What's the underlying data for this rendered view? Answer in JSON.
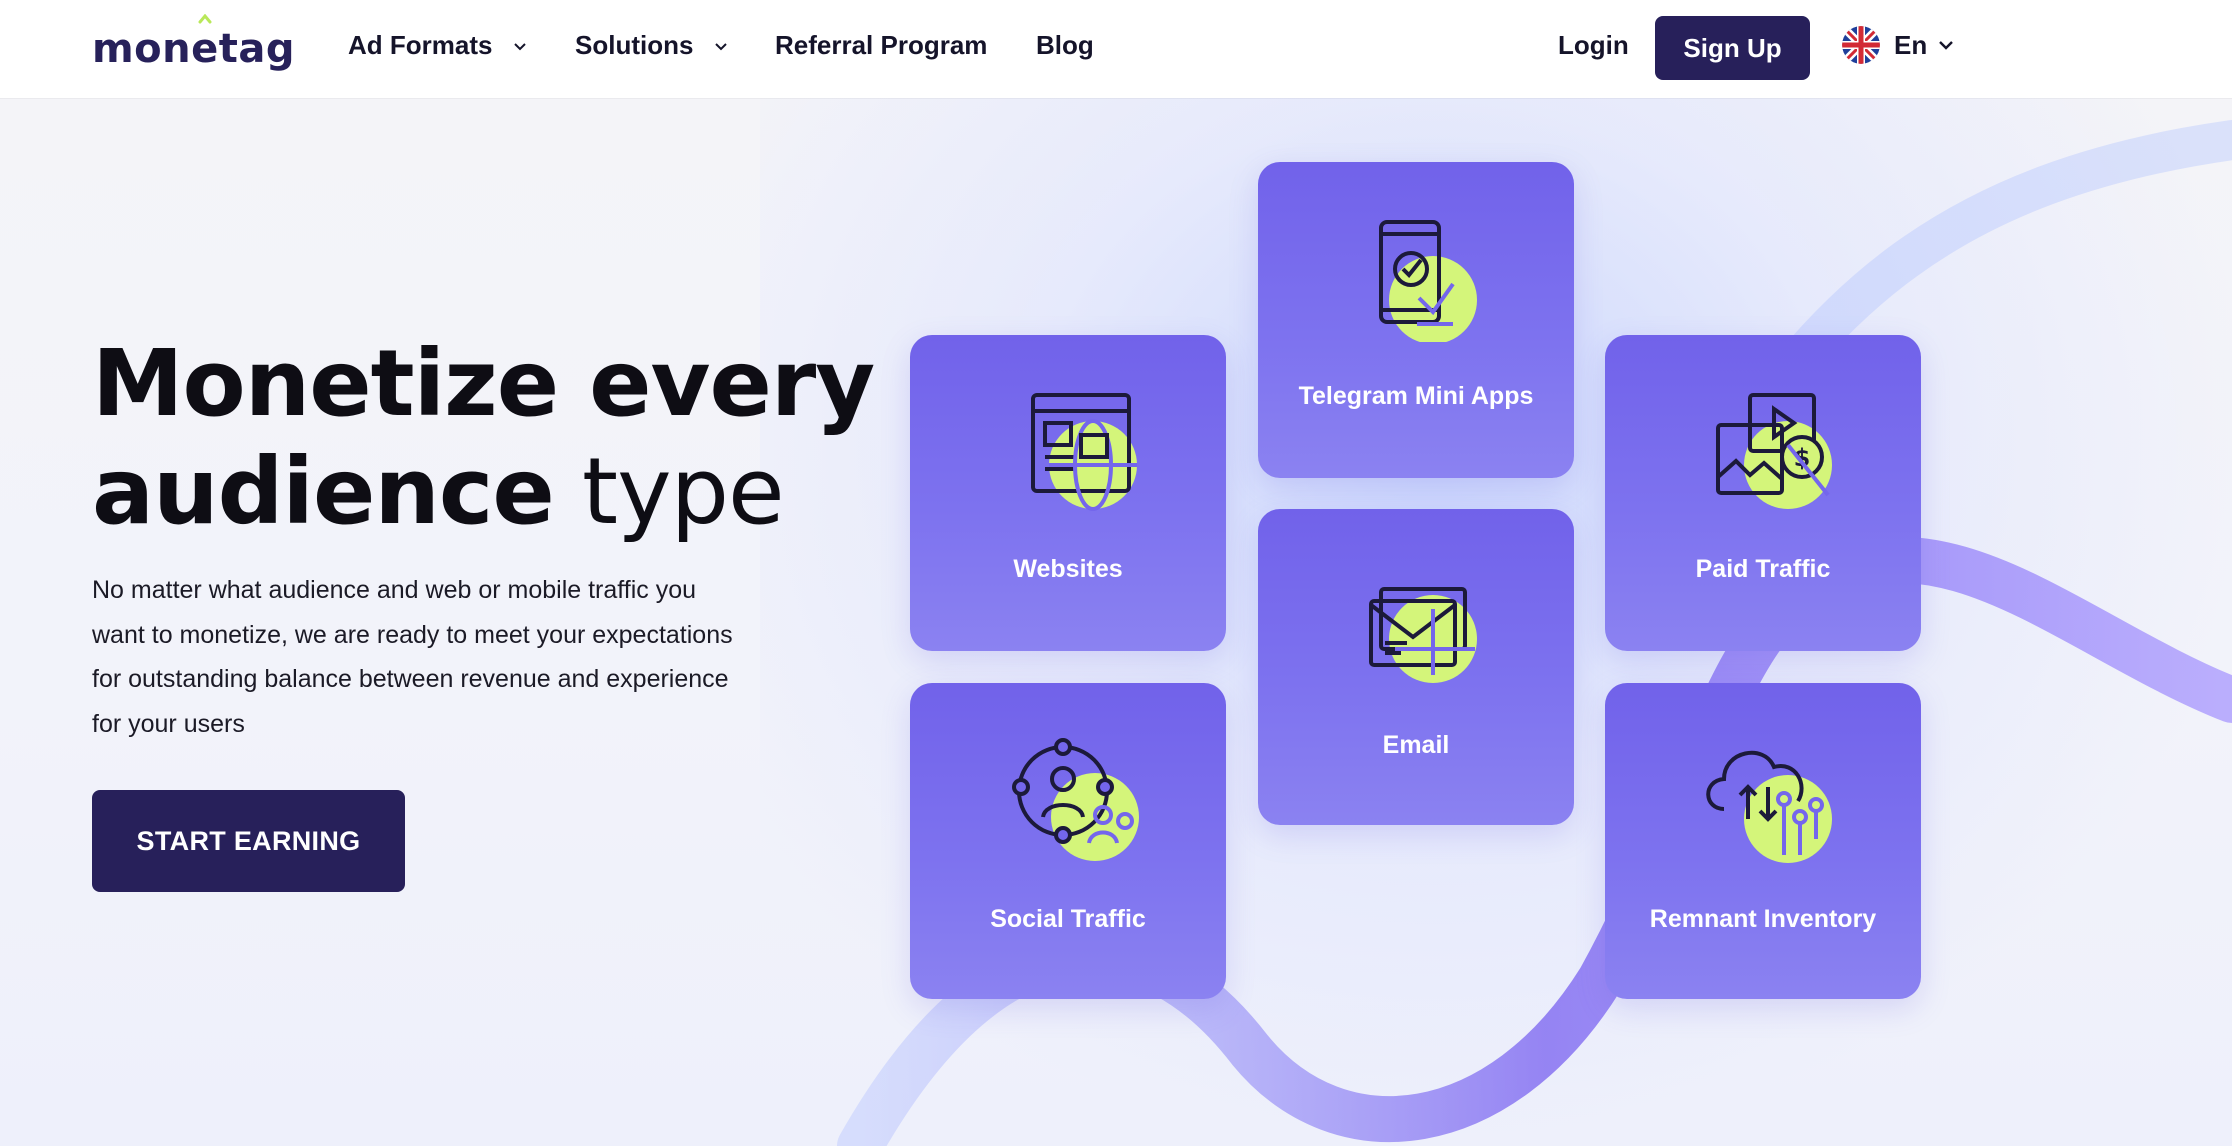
{
  "header": {
    "logo": {
      "pre": "mon",
      "e": "e",
      "post": "tag"
    },
    "nav": [
      {
        "label": "Ad Formats",
        "has_dropdown": true
      },
      {
        "label": "Solutions",
        "has_dropdown": true
      },
      {
        "label": "Referral Program",
        "has_dropdown": false
      },
      {
        "label": "Blog",
        "has_dropdown": false
      }
    ],
    "login_label": "Login",
    "signup_label": "Sign Up",
    "language": {
      "label": "En",
      "flag_icon": "uk-flag-icon"
    }
  },
  "hero": {
    "title_line1": "Monetize every",
    "title_line2_bold": "audience",
    "title_line2_light": "type",
    "description": "No matter what audience and web or mobile traffic you want to monetize, we are ready to meet your expectations for outstanding balance between revenue and experience for your users",
    "cta_label": "START EARNING"
  },
  "cards": [
    {
      "id": "websites",
      "label": "Websites",
      "icon": "website-globe-icon"
    },
    {
      "id": "telegram",
      "label": "Telegram Mini Apps",
      "icon": "phone-check-icon"
    },
    {
      "id": "paid",
      "label": "Paid Traffic",
      "icon": "media-dollar-icon"
    },
    {
      "id": "social",
      "label": "Social Traffic",
      "icon": "social-network-icon"
    },
    {
      "id": "email",
      "label": "Email",
      "icon": "envelope-icon"
    },
    {
      "id": "remnant",
      "label": "Remnant Inventory",
      "icon": "cloud-transfer-icon"
    }
  ],
  "colors": {
    "brand_dark": "#27205a",
    "card_purple": "#7466ec",
    "accent_lime": "#d4f57a"
  }
}
